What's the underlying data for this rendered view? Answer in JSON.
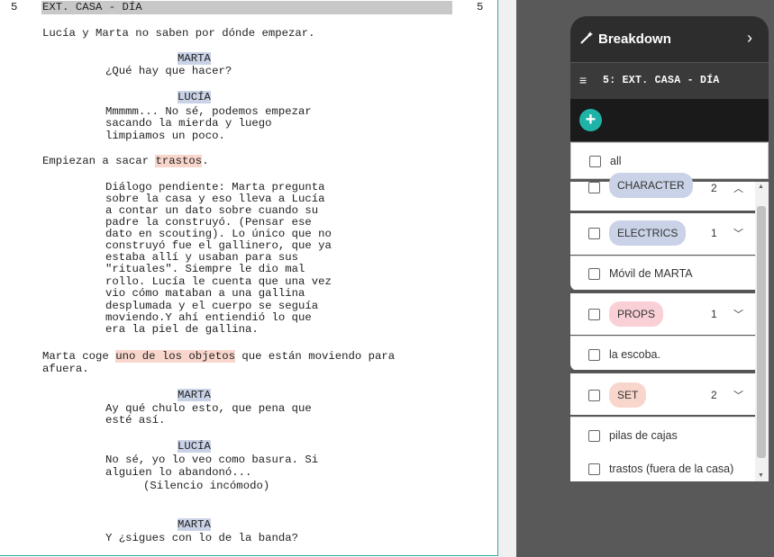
{
  "script": {
    "scene_number_left": "5",
    "scene_heading": "EXT. CASA - DÍA",
    "scene_number_right": "5",
    "action1": "Lucía y Marta no saben por dónde empezar.",
    "char1": "MARTA",
    "dialog1": "¿Qué hay que hacer?",
    "char2": "LUCÍA",
    "dialog2": [
      "Mmmmm... No sé, podemos empezar",
      "sacando la mierda y luego",
      "limpiamos un poco."
    ],
    "action2_pre": "Empiezan a sacar ",
    "action2_tag": "trastos",
    "action2_post": ".",
    "note": [
      "Diálogo pendiente: Marta pregunta",
      "sobre la casa y eso lleva a Lucía",
      "a contar un dato sobre cuando su",
      "padre la construyó. (Pensar ese",
      "dato en scouting). Lo único que no",
      "construyó fue el gallinero, que ya",
      "estaba allí y usaban para sus",
      "\"rituales\". Siempre le dio mal",
      "rollo. Lucía le cuenta que una vez",
      "vio cómo mataban a una gallina",
      "desplumada y el cuerpo se seguía",
      "moviendo.Y ahí entiendió lo que",
      "era la piel de gallina."
    ],
    "action3_pre": "Marta coge ",
    "action3_tag": "uno de los objetos",
    "action3_post": " que están moviendo para",
    "action3_line2": "afuera.",
    "char3": "MARTA",
    "dialog3": [
      "Ay qué chulo esto, que pena que",
      "esté así."
    ],
    "char4": "LUCÍA",
    "dialog4": [
      "No sé, yo lo veo como basura. Si",
      "alguien lo abandonó..."
    ],
    "paren4": "(Silencio incómodo)",
    "char5": "MARTA",
    "dialog5": "Y ¿sigues con lo de la banda?"
  },
  "breakdown": {
    "title": "Breakdown",
    "title_icon": "magic-wand-icon",
    "expand_icon": "chevron-right-icon",
    "scene_label": "5: EXT. CASA - DÍA",
    "menu_icon": "hamburger-icon",
    "add_icon": "plus-circle-icon",
    "all_label": "all",
    "categories": [
      {
        "name": "CHARACTER",
        "count": "2",
        "color": "#c9d2e6",
        "expanded": true,
        "items": []
      },
      {
        "name": "ELECTRICS",
        "count": "1",
        "color": "#c9d2e6",
        "expanded": false,
        "items": [
          "Móvil de MARTA"
        ]
      },
      {
        "name": "PROPS",
        "count": "1",
        "color": "#f9d0d6",
        "expanded": false,
        "items": [
          "la escoba."
        ]
      },
      {
        "name": "SET",
        "count": "2",
        "color": "#f9d6cc",
        "expanded": false,
        "items": [
          "pilas de cajas",
          "trastos (fuera de la casa)"
        ]
      }
    ]
  },
  "colors": {
    "accent": "#1fb3a8",
    "character_tag": "#c9d2e6",
    "set_tag": "#f9d6cc",
    "panel_dark": "#2d2d2d"
  }
}
